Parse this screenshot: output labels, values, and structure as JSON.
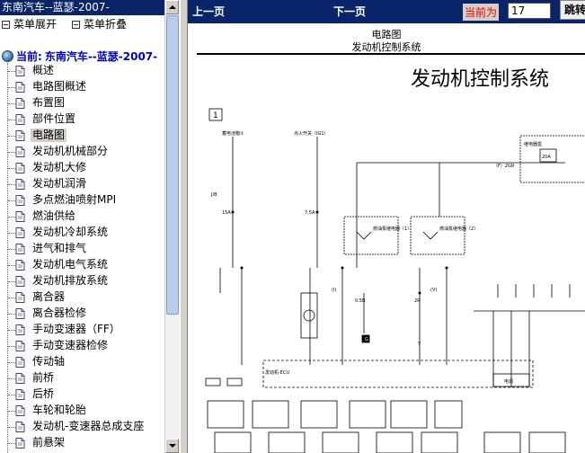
{
  "left_panel": {
    "title": "东南汽车--蓝瑟-2007-",
    "toolbar": {
      "expand_label": "菜单展开",
      "collapse_label": "菜单折叠"
    },
    "current_prefix": "当前:",
    "current_model": "东南汽车--蓝瑟-2007-",
    "items": [
      "概述",
      "电路图概述",
      "布置图",
      "部件位置",
      "电路图",
      "发动机机械部分",
      "发动机大修",
      "发动机润滑",
      "多点燃油喷射MPI",
      "燃油供给",
      "发动机冷却系统",
      "进气和排气",
      "发动机电气系统",
      "发动机排放系统",
      "离合器",
      "离合器检修",
      "手动变速器（FF）",
      "手动变速器检修",
      "传动轴",
      "前桥",
      "后桥",
      "车轮和轮胎",
      "发动机-变速器总成支座",
      "前悬架"
    ],
    "selected_item": "电路图"
  },
  "navbar": {
    "prev_label": "上一页",
    "next_label": "下一页",
    "current_label": "当前为",
    "page_value": "17",
    "jump_label": "跳转"
  },
  "document": {
    "category": "电路图",
    "subtitle": "发动机控制系统",
    "title": "发动机控制系统",
    "figure_number": "1",
    "labels": {
      "ig_switch": "点火开关（IG1）",
      "fuse_box": "蓄电池箱①",
      "relay_box": "继电器盒",
      "pump_relay1": "燃油泵继电器（1）",
      "pump_relay2": "燃油泵继电器（2）",
      "ecu": "发动机-ECU",
      "junction": "J/B",
      "ground": "G",
      "power": "电源",
      "fuse_15a": "15A",
      "fuse_75a": "7.5A",
      "fuse_20a": "20A",
      "wire_2gr": "（F）2GR",
      "wire_1": "(I)",
      "wire_2": "(V)",
      "w_05b": "0.5B",
      "w_2r": "2R",
      "w_y": "Y"
    },
    "colors": {
      "navbar": "#0a246a",
      "current_label": "#e00000",
      "selected_bg": "#d4d0c8"
    }
  }
}
